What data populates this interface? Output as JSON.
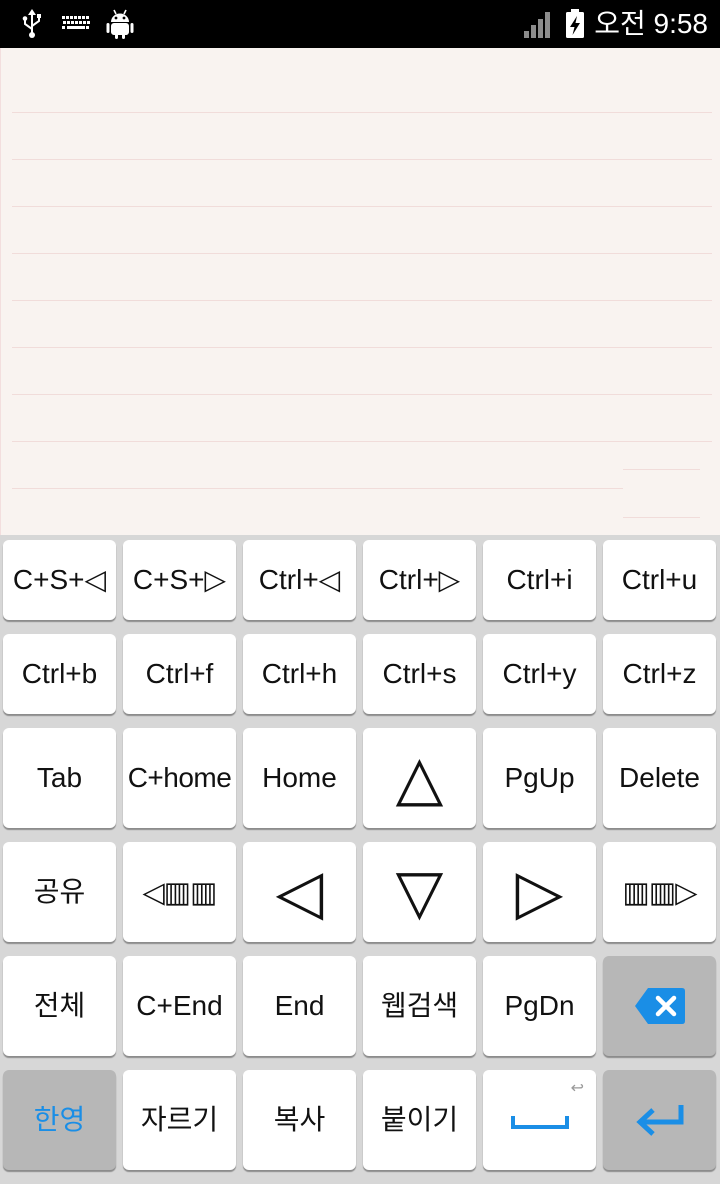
{
  "status_bar": {
    "time": "오전 9:58",
    "left_icons": [
      "usb-icon",
      "keyboard-icon",
      "android-debug-icon"
    ],
    "right_icons": [
      "signal-icon",
      "battery-charging-icon"
    ]
  },
  "keyboard": {
    "rows": [
      [
        "C+S+◁",
        "C+S+▷",
        "Ctrl+◁",
        "Ctrl+▷",
        "Ctrl+i",
        "Ctrl+u"
      ],
      [
        "Ctrl+b",
        "Ctrl+f",
        "Ctrl+h",
        "Ctrl+s",
        "Ctrl+y",
        "Ctrl+z"
      ],
      [
        "Tab",
        "C+home",
        "Home",
        "△",
        "PgUp",
        "Delete"
      ],
      [
        "공유",
        "◁▥▥",
        "◁",
        "▽",
        "▷",
        "▥▥▷"
      ],
      [
        "전체",
        "C+End",
        "End",
        "웹검색",
        "PgDn"
      ],
      [
        "한영",
        "자르기",
        "복사",
        "붙이기"
      ]
    ],
    "backspace_key": {
      "icon": "backspace-icon"
    },
    "space_key": {
      "icon": "space-bar-icon",
      "hint": "↩"
    },
    "enter_key": {
      "icon": "enter-icon"
    }
  },
  "colors": {
    "accent": "#1a8ee6",
    "key": "#ffffff",
    "special": "#b7b7b7",
    "kb": "#d7d7d7",
    "editor": "#f9f3f0",
    "rule": "#f1dcda",
    "bar": "#000000"
  }
}
